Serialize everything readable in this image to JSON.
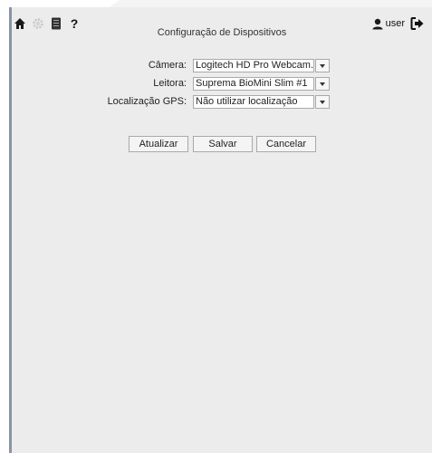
{
  "toolbar": {
    "icons": [
      "home-icon",
      "gear-icon",
      "device-icon",
      "help-icon"
    ],
    "help_label": "?",
    "user_name": "user"
  },
  "config": {
    "title": "Configuração de Dispositivos",
    "camera_label": "Câmera:",
    "camera_value": "Logitech HD Pro Webcam...",
    "reader_label": "Leitora:",
    "reader_value": "Suprema BioMini Slim #1",
    "gps_label": "Localização GPS:",
    "gps_value": "Não utilizar localização"
  },
  "buttons": {
    "refresh": "Atualizar",
    "save": "Salvar",
    "cancel": "Cancelar"
  },
  "colors": {
    "background": "#ececec",
    "accent_bar": "#8a94a6"
  }
}
